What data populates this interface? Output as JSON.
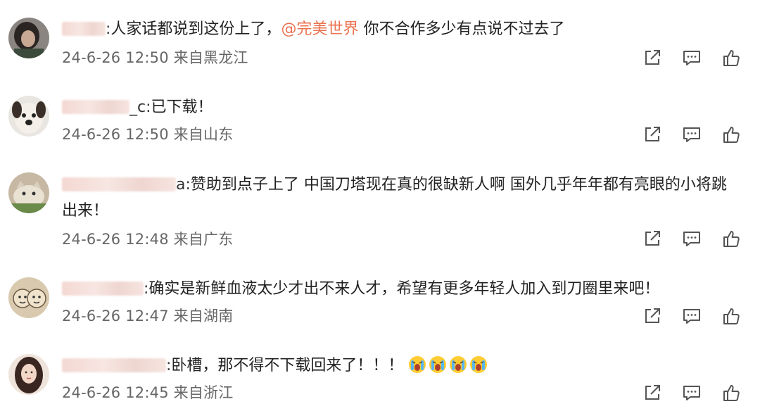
{
  "comments": [
    {
      "name_tail": ":",
      "text_before": "人家话都说到这份上了，",
      "mention": "@完美世界",
      "text_after": " 你不合作多少有点说不过去了",
      "text_cont": "",
      "meta": "24-6-26 12:50 来自黑龙江",
      "avatar": "dark-hair-avatar"
    },
    {
      "name_tail": "_c:",
      "text_before": "已下载！",
      "mention": "",
      "text_after": "",
      "text_cont": "",
      "meta": "24-6-26 12:50 来自山东",
      "avatar": "dog-avatar"
    },
    {
      "name_tail": "a:",
      "text_before": "赞助到点子上了 中国刀塔现在真的很缺新人啊 国外几乎年年都有亮眼的小将跳",
      "mention": "",
      "text_after": "",
      "text_cont": "出来！",
      "meta": "24-6-26 12:48 来自广东",
      "avatar": "cat-avatar"
    },
    {
      "name_tail": ":",
      "text_before": "确实是新鲜血液太少才出不来人才，希望有更多年轻人加入到刀圈里来吧！",
      "mention": "",
      "text_after": "",
      "text_cont": "",
      "meta": "24-6-26 12:47 来自湖南",
      "avatar": "faces-avatar"
    },
    {
      "name_tail": ":",
      "text_before": "卧槽，那不得不下载回来了！！！",
      "mention": "",
      "text_after": "",
      "text_cont": "",
      "meta": "24-6-26 12:45 来自浙江",
      "avatar": "girl-avatar",
      "emojis": [
        "crying-emoji",
        "crying-emoji",
        "crying-emoji",
        "crying-emoji"
      ]
    }
  ],
  "colors": {
    "mention": "#eb7350",
    "meta": "#666666",
    "icon": "#555555"
  },
  "icons": {
    "share": "share-icon",
    "reply": "comment-icon",
    "like": "thumbs-up-icon"
  }
}
